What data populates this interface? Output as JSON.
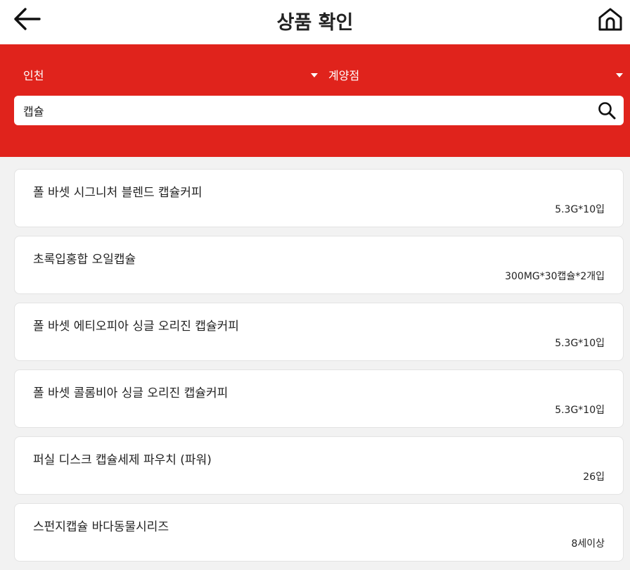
{
  "header": {
    "title": "상품 확인",
    "back_icon": "arrow-left-icon",
    "home_icon": "home-icon"
  },
  "filters": {
    "region": "인천",
    "store": "계양점"
  },
  "search": {
    "value": "캡슐",
    "icon": "search-icon"
  },
  "colors": {
    "accent": "#e0231c",
    "background": "#f2f2f2"
  },
  "products": [
    {
      "name": "폴 바셋 시그니처 블렌드 캡슐커피",
      "spec": "5.3G*10입"
    },
    {
      "name": "초록입홍합 오일캡슐",
      "spec": "300MG*30캡슐*2개입"
    },
    {
      "name": "폴 바셋 에티오피아 싱글 오리진 캡슐커피",
      "spec": "5.3G*10입"
    },
    {
      "name": "폴 바셋 콜롬비아 싱글 오리진 캡슐커피",
      "spec": "5.3G*10입"
    },
    {
      "name": "퍼실 디스크 캡슐세제 파우치 (파워)",
      "spec": "26입"
    },
    {
      "name": "스펀지캡슐 바다동물시리즈",
      "spec": "8세이상"
    }
  ]
}
